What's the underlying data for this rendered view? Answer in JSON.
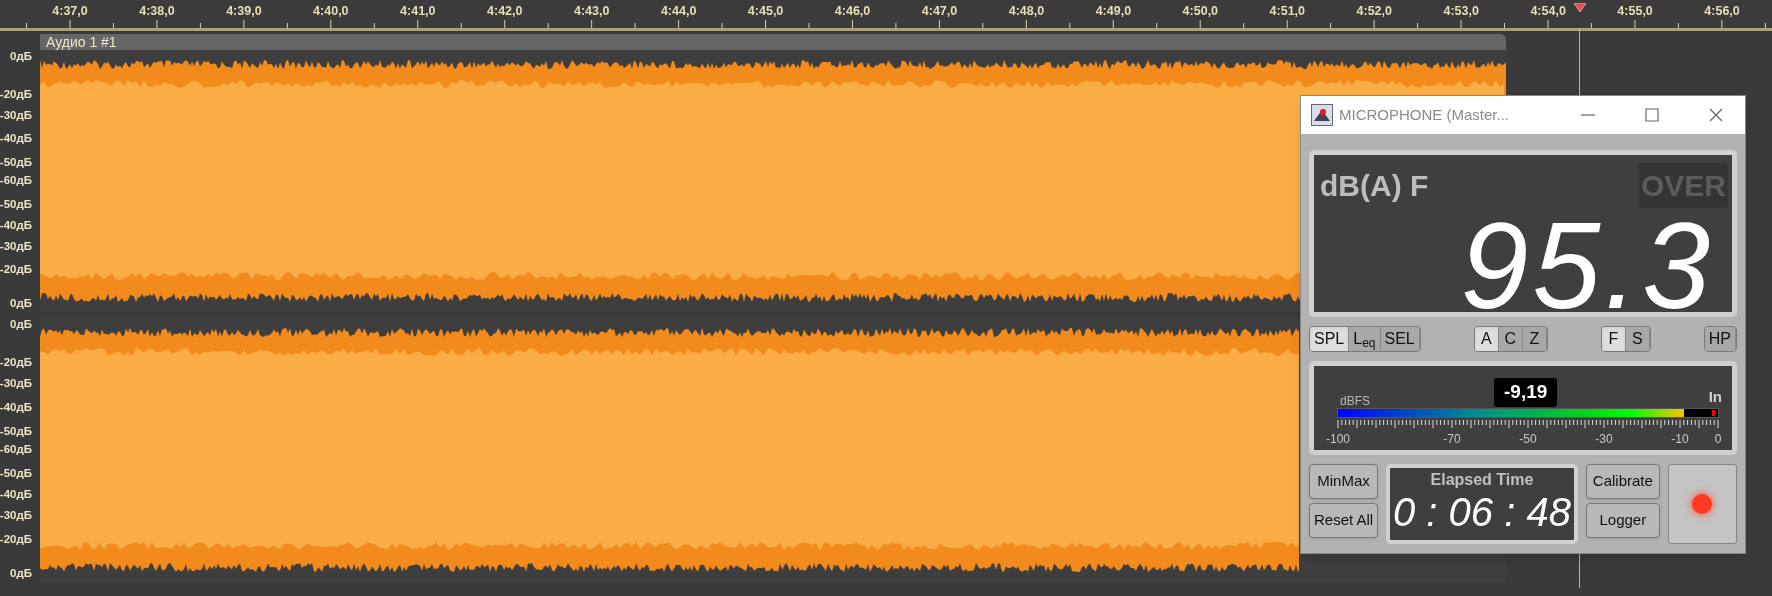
{
  "ruler": {
    "labels": [
      "4:37,0",
      "4:38,0",
      "4:39,0",
      "4:40,0",
      "4:41,0",
      "4:42,0",
      "4:43,0",
      "4:44,0",
      "4:45,0",
      "4:46,0",
      "4:47,0",
      "4:48,0",
      "4:49,0",
      "4:50,0",
      "4:51,0",
      "4:52,0",
      "4:53,0",
      "4:54,0",
      "4:55,0",
      "4:56,0"
    ]
  },
  "track": {
    "title": "Аудио 1 #1",
    "channels": [
      {
        "scale": [
          "0дБ",
          "-20дБ",
          "-30дБ",
          "-40дБ",
          "-50дБ",
          "-60дБ",
          "-50дБ",
          "-40дБ",
          "-30дБ",
          "-20дБ",
          "0дБ"
        ]
      },
      {
        "scale": [
          "0дБ",
          "-20дБ",
          "-30дБ",
          "-40дБ",
          "-50дБ",
          "-60дБ",
          "-50дБ",
          "-40дБ",
          "-30дБ",
          "-20дБ",
          "0дБ"
        ]
      }
    ]
  },
  "meter_window": {
    "title": "MICROPHONE (Master...",
    "display": {
      "mode": "dB(A) F",
      "over": {
        "text": "OVER",
        "on": false
      },
      "value": "95.3"
    },
    "button_groups": [
      [
        {
          "label": "SPL",
          "selected": true
        },
        {
          "label": "L$_{eq}$",
          "selected": false
        },
        {
          "label": "SEL",
          "selected": false
        }
      ],
      [
        {
          "label": "A",
          "selected": true
        },
        {
          "label": "C",
          "selected": false
        },
        {
          "label": "Z",
          "selected": false
        }
      ],
      [
        {
          "label": "F",
          "selected": true
        },
        {
          "label": "S",
          "selected": false
        }
      ],
      [
        {
          "label": "HP",
          "selected": false
        }
      ]
    ],
    "level_meter": {
      "unit": "dBFS",
      "reading": "-9,19",
      "channel": "In",
      "level": 0.91,
      "scale": [
        "-100",
        "-70",
        "-50",
        "-30",
        "-10",
        "0"
      ]
    },
    "minmax": "MinMax",
    "reset": "Reset All",
    "elapsed": {
      "label": "Elapsed Time",
      "value": "0 : 06 : 48"
    },
    "calibrate": "Calibrate",
    "logger": "Logger",
    "record": {
      "on": true
    }
  }
}
